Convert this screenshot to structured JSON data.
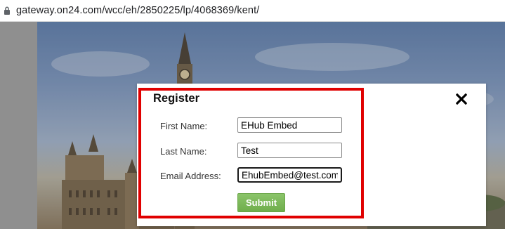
{
  "browser": {
    "url": "gateway.on24.com/wcc/eh/2850225/lp/4068369/kent/",
    "lock_icon": "lock-icon"
  },
  "modal": {
    "title": "Register",
    "close_icon": "close-icon",
    "fields": [
      {
        "label": "First Name:",
        "value": "EHub Embed"
      },
      {
        "label": "Last Name:",
        "value": "Test"
      },
      {
        "label": "Email Address:",
        "value": "EhubEmbed@test.com"
      }
    ],
    "submit_label": "Submit"
  },
  "colors": {
    "highlight": "#e00000",
    "submit": "#78b556"
  }
}
